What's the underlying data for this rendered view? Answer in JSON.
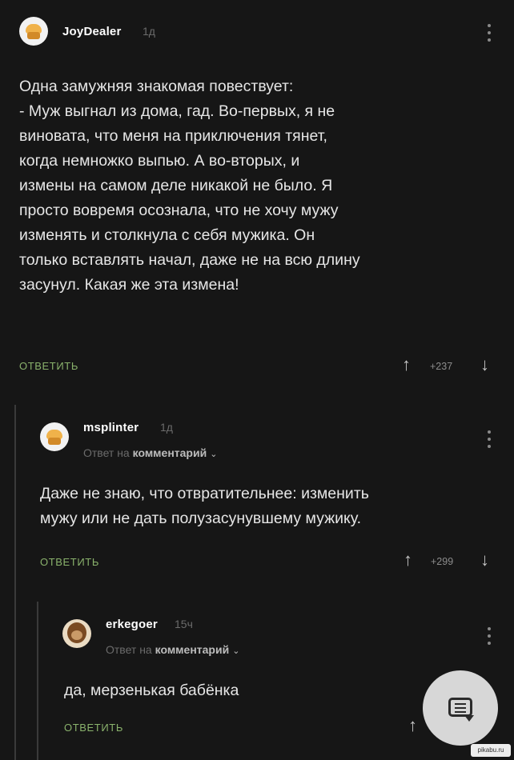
{
  "comments": [
    {
      "username": "JoyDealer",
      "time": "1д",
      "lines": [
        "Одна замужняя знакомая повествует:",
        "- Муж выгнал из дома, гад. Во-первых, я не",
        "виновата, что меня на приключения тянет,",
        "когда немножко выпью. А во-вторых, и",
        "измены на самом деле никакой не было. Я",
        "просто вовремя осознала, что не хочу мужу",
        "изменять и столкнула с себя мужика. Он",
        "только вставлять начал, даже не на всю длину",
        "засунул. Какая же эта измена!"
      ],
      "reply_label": "ОТВЕТИТЬ",
      "rating": "+237"
    },
    {
      "username": "msplinter",
      "time": "1д",
      "reply_to_prefix": "Ответ на",
      "reply_to_link": "комментарий",
      "lines": [
        "Даже не знаю, что отвратительнее: изменить",
        "мужу или не дать полузасунувшему мужику."
      ],
      "reply_label": "ОТВЕТИТЬ",
      "rating": "+299"
    },
    {
      "username": "erkegoer",
      "time": "15ч",
      "reply_to_prefix": "Ответ на",
      "reply_to_link": "комментарий",
      "lines": [
        "да, мерзенькая бабёнка"
      ],
      "reply_label": "ОТВЕТИТЬ"
    }
  ],
  "icons": {
    "vote_up": "arrow-up-icon",
    "vote_down": "arrow-down-icon",
    "more": "kebab-menu-icon",
    "chevron": "chevron-down-icon",
    "fab": "comment-icon"
  },
  "colors": {
    "background": "#161616",
    "reply_button": "#8ab26c",
    "meta_text": "#6b6b6b",
    "fab_background": "#d7d7d7"
  },
  "watermark": "pikabu.ru"
}
